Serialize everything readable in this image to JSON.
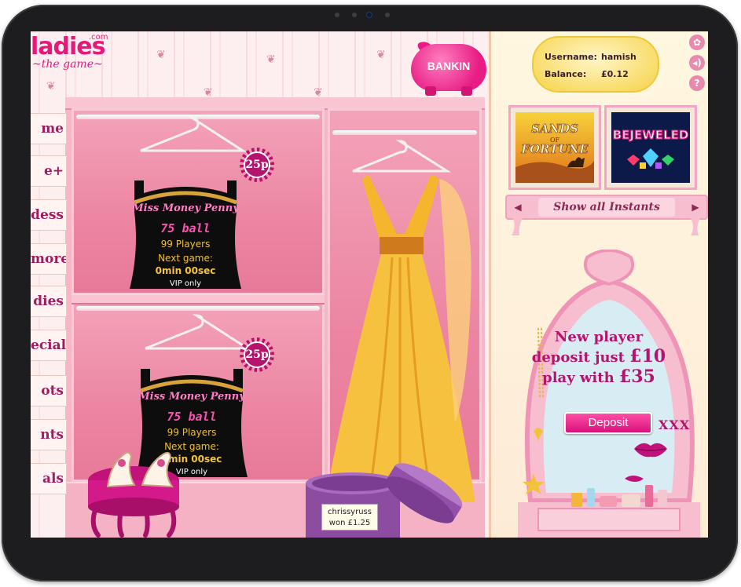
{
  "logo": {
    "brand": "ladies",
    "domain": ".com",
    "tagline": "the game"
  },
  "bank": {
    "label": "BANKIN"
  },
  "nav": {
    "tabs": [
      "me",
      "e+",
      "dess",
      "more",
      "dies",
      "ecials",
      "ots",
      "nts",
      "als"
    ]
  },
  "rooms": [
    {
      "name": "Miss Money Penny",
      "price": "25p",
      "type": "75  ball",
      "players": "99 Players",
      "next_label": "Next game:",
      "timer": "0min 00sec",
      "access": "VIP only"
    },
    {
      "name": "Miss Money Penny",
      "price": "25p",
      "type": "75  ball",
      "players": "99 Players",
      "next_label": "Next game:",
      "timer": "0min 00sec",
      "access": "VIP only"
    }
  ],
  "winner": {
    "name": "chrissyruss",
    "text": "won £1.25"
  },
  "user": {
    "username_label": "Username:",
    "username": "hamish",
    "balance_label": "Balance:",
    "balance": "£0.12"
  },
  "games": [
    {
      "title_line1": "SANDS",
      "title_line2": "FORTUNE",
      "connector": "OF"
    },
    {
      "title": "BEJEWELED"
    }
  ],
  "instants": {
    "label": "Show all Instants",
    "prev_icon": "arrow-left",
    "next_icon": "arrow-right"
  },
  "promo": {
    "line1": "New player",
    "line2_prefix": "deposit just",
    "line2_amount": "£10",
    "line3_prefix": "play with",
    "line3_amount": "£35",
    "button": "Deposit",
    "sign": "XXX"
  },
  "colors": {
    "brand_pink": "#e6197a",
    "deep_pink": "#b5146c",
    "gold": "#f0c030"
  }
}
